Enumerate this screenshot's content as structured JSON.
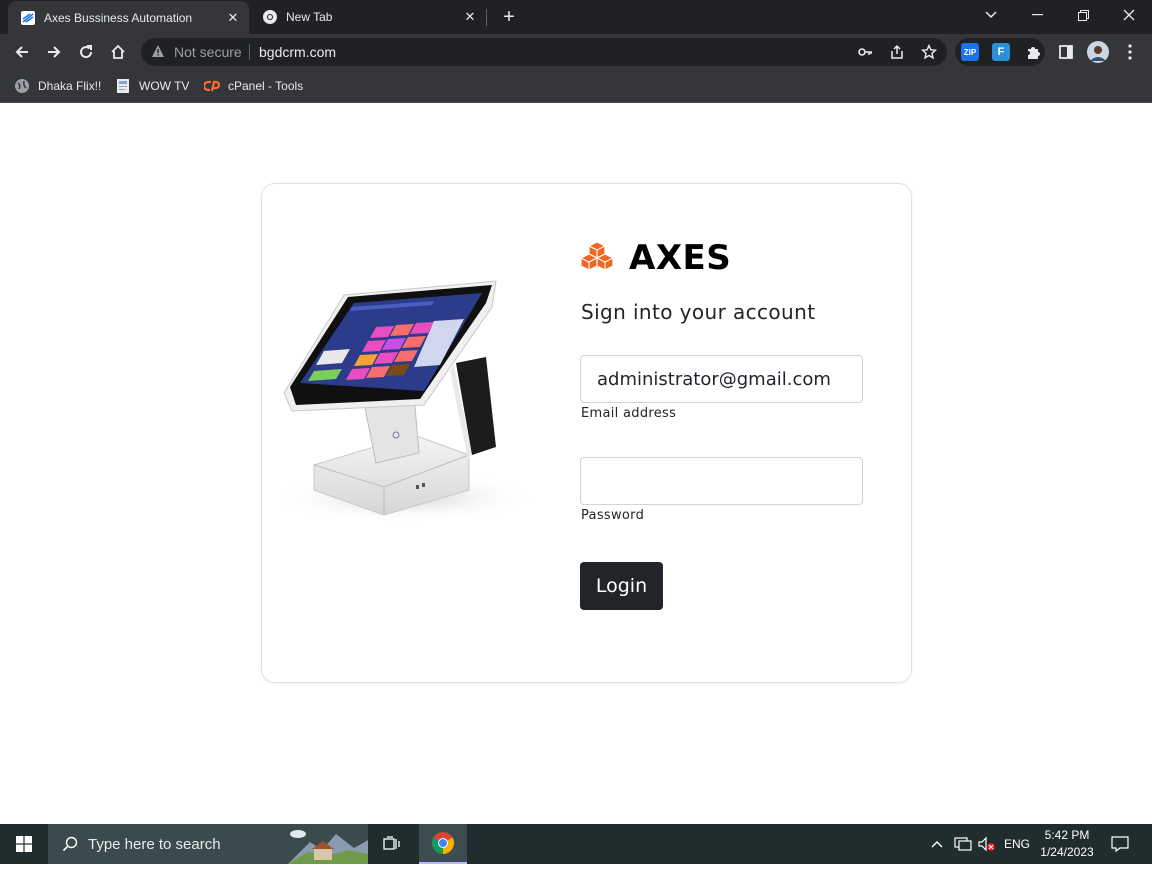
{
  "browser": {
    "tabs": [
      {
        "title": "Axes Bussiness Automation",
        "active": true
      },
      {
        "title": "New Tab",
        "active": false
      }
    ],
    "new_tab_label": "+",
    "security_label": "Not secure",
    "url": "bgdcrm.com",
    "bookmarks": [
      {
        "label": "Dhaka Flix!!",
        "icon": "globe-icon"
      },
      {
        "label": "WOW TV",
        "icon": "page-icon"
      },
      {
        "label": "cPanel - Tools",
        "icon": "cpanel-icon"
      }
    ],
    "extensions": [
      {
        "label": "ZIP",
        "color": "#1a73e8"
      },
      {
        "label": "F",
        "color": "#2b90d9"
      }
    ]
  },
  "login": {
    "brand_name": "AXES",
    "brand_color": "#f26522",
    "subtitle": "Sign into your account",
    "email_value": "administrator@gmail.com",
    "email_label": "Email address",
    "password_value": "",
    "password_label": "Password",
    "submit_label": "Login"
  },
  "taskbar": {
    "search_placeholder": "Type here to search",
    "language": "ENG",
    "time": "5:42 PM",
    "date": "1/24/2023"
  }
}
